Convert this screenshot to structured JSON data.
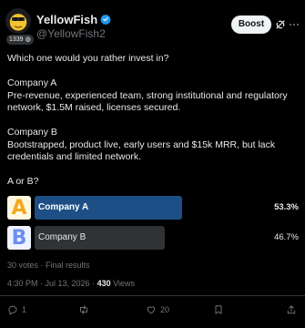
{
  "author": {
    "display_name": "YellowFish",
    "handle": "@YellowFish2",
    "level_badge": "1339 ◍"
  },
  "header": {
    "boost_label": "Boost"
  },
  "post": {
    "paragraphs": [
      "Which one would you rather invest in?",
      "Company A",
      "Pre-revenue, experienced team, strong institutional and regulatory network, $1.5M raised, licenses secured.",
      "Company B",
      "Bootstrapped, product live, early users and $15k MRR, but lack credentials and limited network.",
      "A or B?"
    ]
  },
  "poll": {
    "options": [
      {
        "label": "Company A",
        "percent": "53.3%",
        "share": 0.533,
        "leading": true,
        "image_letter": "A"
      },
      {
        "label": "Company B",
        "percent": "46.7%",
        "share": 0.467,
        "leading": false,
        "image_letter": "B"
      }
    ],
    "summary": "30 votes · Final results"
  },
  "meta": {
    "time_date": "4:30 PM · Jul 13, 2026 · ",
    "views_count": "430",
    "views_label": " Views"
  },
  "actions": {
    "replies": "1",
    "reposts": "",
    "likes": "20",
    "bookmarks": ""
  },
  "colors": {
    "background": "#000000",
    "leading_bar": "#1d4f86",
    "other_bar": "#2f3336",
    "verified": "#1d9bf0",
    "muted_text": "#71767b"
  }
}
